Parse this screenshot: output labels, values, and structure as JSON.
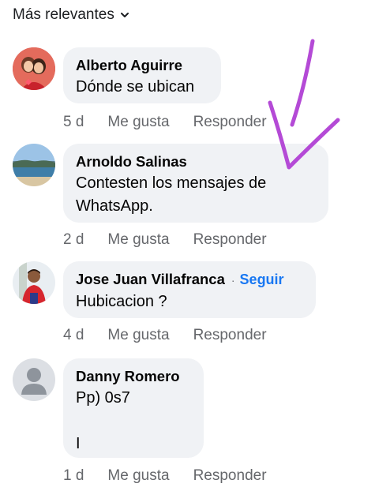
{
  "sort": {
    "label": "Más relevantes",
    "icon": "chevron-down-icon"
  },
  "comments": [
    {
      "author": "Alberto Aguirre",
      "text": "Dónde se ubican",
      "time": "5 d",
      "like": "Me gusta",
      "reply": "Responder",
      "avatar": "avatar-photo-couple"
    },
    {
      "author": "Arnoldo Salinas",
      "text": "Contesten los mensajes de\nWhatsApp.",
      "time": "2 d",
      "like": "Me gusta",
      "reply": "Responder",
      "avatar": "avatar-photo-beach"
    },
    {
      "author": "Jose Juan Villafranca",
      "follow": "Seguir",
      "follow_sep": "·",
      "text": "Hubicacion ?",
      "time": "4 d",
      "like": "Me gusta",
      "reply": "Responder",
      "avatar": "avatar-photo-man"
    },
    {
      "author": "Danny Romero",
      "text": "Pp) 0s7\n\nI",
      "time": "1 d",
      "like": "Me gusta",
      "reply": "Responder",
      "avatar": "default-avatar-icon"
    }
  ],
  "colors": {
    "bubble": "#f0f2f5",
    "meta": "#65676b",
    "link": "#1877f2",
    "annotation": "#b44ad6"
  }
}
